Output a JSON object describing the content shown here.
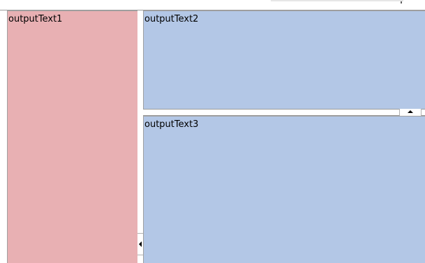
{
  "panes": {
    "left": {
      "text": "outputText1",
      "color": "#e8b0b3"
    },
    "right_top": {
      "text": "outputText2",
      "color": "#b3c7e6"
    },
    "right_bottom": {
      "text": "outputText3",
      "color": "#b3c7e6"
    }
  },
  "splitters": {
    "vertical": {
      "icon": "collapse-left-arrow-icon"
    },
    "horizontal": {
      "icon": "collapse-up-arrow-icon"
    }
  }
}
